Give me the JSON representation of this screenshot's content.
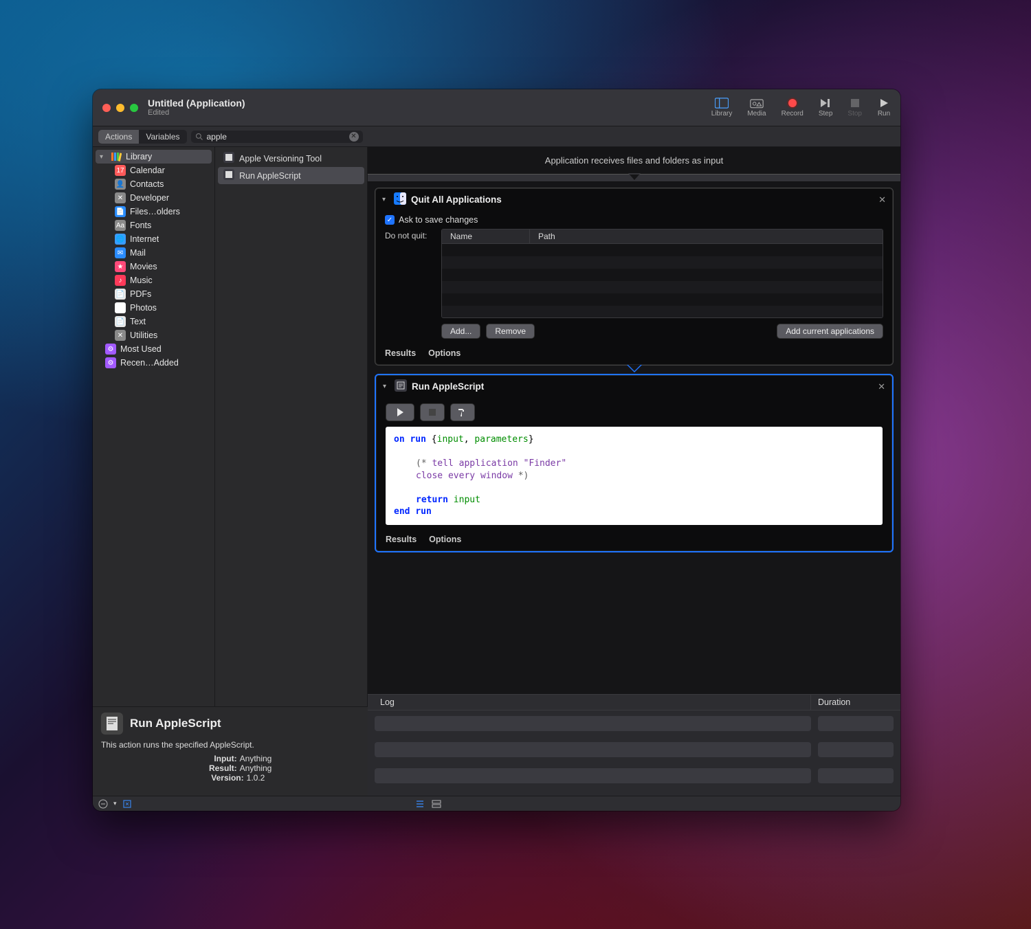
{
  "window": {
    "title": "Untitled (Application)",
    "subtitle": "Edited"
  },
  "toolbar": {
    "library": "Library",
    "media": "Media",
    "record": "Record",
    "step": "Step",
    "stop": "Stop",
    "run": "Run"
  },
  "subtoolbar": {
    "actions": "Actions",
    "variables": "Variables",
    "search_value": "apple"
  },
  "library": {
    "root": "Library",
    "items": [
      {
        "label": "Calendar",
        "color": "#ff5a5a",
        "glyph": "17"
      },
      {
        "label": "Contacts",
        "color": "#8a8a8a",
        "glyph": "👤"
      },
      {
        "label": "Developer",
        "color": "#8a8a8a",
        "glyph": "✕"
      },
      {
        "label": "Files…olders",
        "color": "#2a8cff",
        "glyph": "📄"
      },
      {
        "label": "Fonts",
        "color": "#8a8a8a",
        "glyph": "Aa"
      },
      {
        "label": "Internet",
        "color": "#3a9cff",
        "glyph": "🌐"
      },
      {
        "label": "Mail",
        "color": "#2a8cff",
        "glyph": "✉"
      },
      {
        "label": "Movies",
        "color": "#ff4a7a",
        "glyph": "★"
      },
      {
        "label": "Music",
        "color": "#ff3a5a",
        "glyph": "♪"
      },
      {
        "label": "PDFs",
        "color": "#e8e8e8",
        "glyph": "📄"
      },
      {
        "label": "Photos",
        "color": "#ffffff",
        "glyph": "❀"
      },
      {
        "label": "Text",
        "color": "#e8e8e8",
        "glyph": "📄"
      },
      {
        "label": "Utilities",
        "color": "#8a8a8a",
        "glyph": "✕"
      }
    ],
    "smart": [
      {
        "label": "Most Used",
        "color": "#a25aff"
      },
      {
        "label": "Recen…Added",
        "color": "#a25aff"
      }
    ]
  },
  "actions_list": [
    {
      "label": "Apple Versioning Tool",
      "selected": false
    },
    {
      "label": "Run AppleScript",
      "selected": true
    }
  ],
  "workflow": {
    "header": "Application receives files and folders as input",
    "quit_action": {
      "title": "Quit All Applications",
      "ask_label": "Ask to save changes",
      "dnq_label": "Do not quit:",
      "col_name": "Name",
      "col_path": "Path",
      "btn_add": "Add...",
      "btn_remove": "Remove",
      "btn_add_current": "Add current applications",
      "tab_results": "Results",
      "tab_options": "Options"
    },
    "script_action": {
      "title": "Run AppleScript",
      "tab_results": "Results",
      "tab_options": "Options",
      "code": {
        "l1a": "on ",
        "l1b": "run",
        "l1c": " {",
        "l1d": "input",
        "l1e": ", ",
        "l1f": "parameters",
        "l1g": "}",
        "l2a": "(* ",
        "l2b": "tell ",
        "l2c": "application",
        "l2d": " \"Finder\"",
        "l3a": "close ",
        "l3b": "every ",
        "l3c": "window",
        "l3d": " *)",
        "l4a": "return ",
        "l4b": "input",
        "l5a": "end ",
        "l5b": "run"
      }
    }
  },
  "log": {
    "col_log": "Log",
    "col_duration": "Duration"
  },
  "info": {
    "title": "Run AppleScript",
    "desc": "This action runs the specified AppleScript.",
    "input_k": "Input:",
    "input_v": "Anything",
    "result_k": "Result:",
    "result_v": "Anything",
    "version_k": "Version:",
    "version_v": "1.0.2"
  }
}
